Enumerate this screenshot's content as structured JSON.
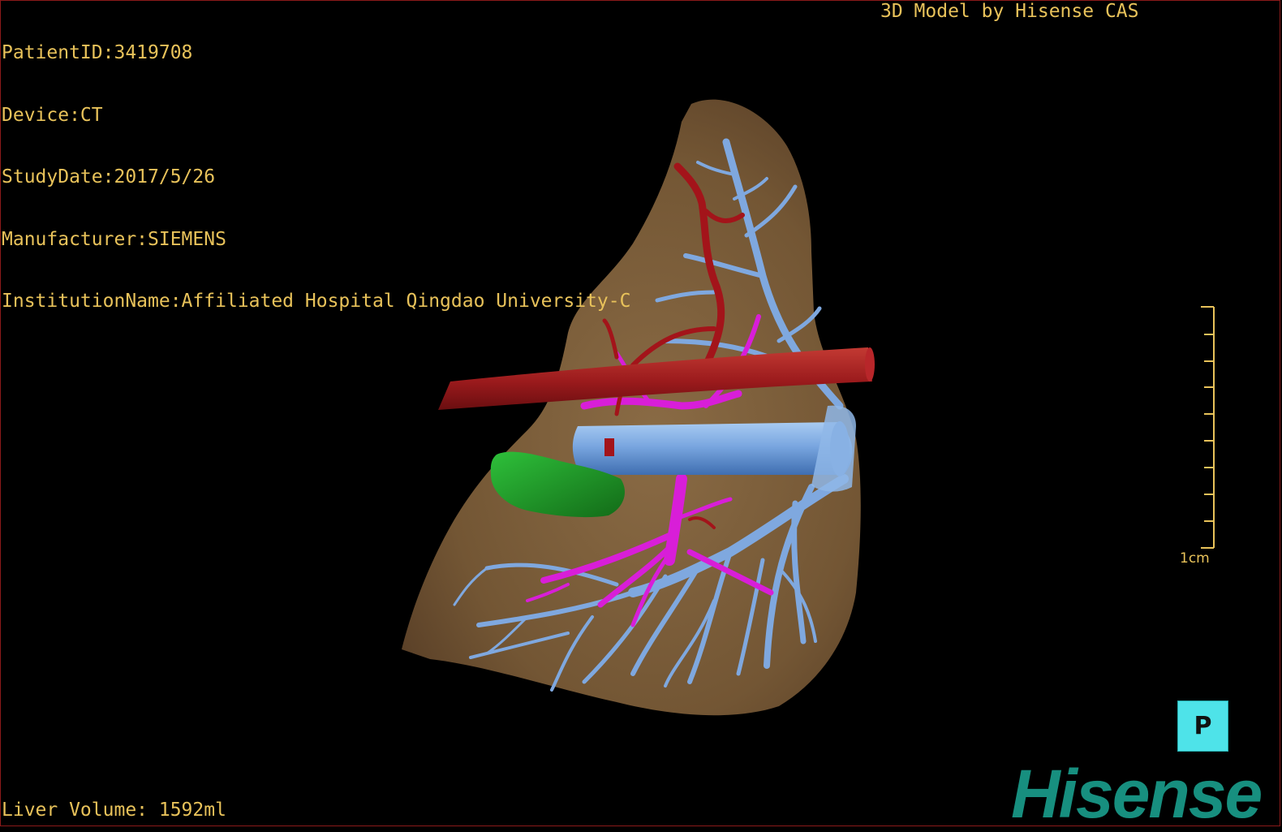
{
  "overlay": {
    "patient_id": "PatientID:3419708",
    "device": "Device:CT",
    "study_date": "StudyDate:2017/5/26",
    "manufacturer": "Manufacturer:SIEMENS",
    "institution": "InstitutionName:Affiliated Hospital Qingdao University-C",
    "model_credit": "3D Model by Hisense CAS",
    "liver_volume": "Liver Volume: 1592ml"
  },
  "scale_bar": {
    "label": "1cm",
    "ticks": 10,
    "color": "#e8c25a"
  },
  "orientation_cube": {
    "label": "P",
    "color": "#4ee3e9"
  },
  "logo": {
    "text": "Hisense",
    "color": "#178f7f"
  },
  "colors": {
    "liver": "#7a5e3c",
    "hepatic_artery": "#a3141a",
    "portal_vein": "#7fa8df",
    "hepatic_vein": "#d81ed8",
    "tumor": "#1c9a24"
  }
}
